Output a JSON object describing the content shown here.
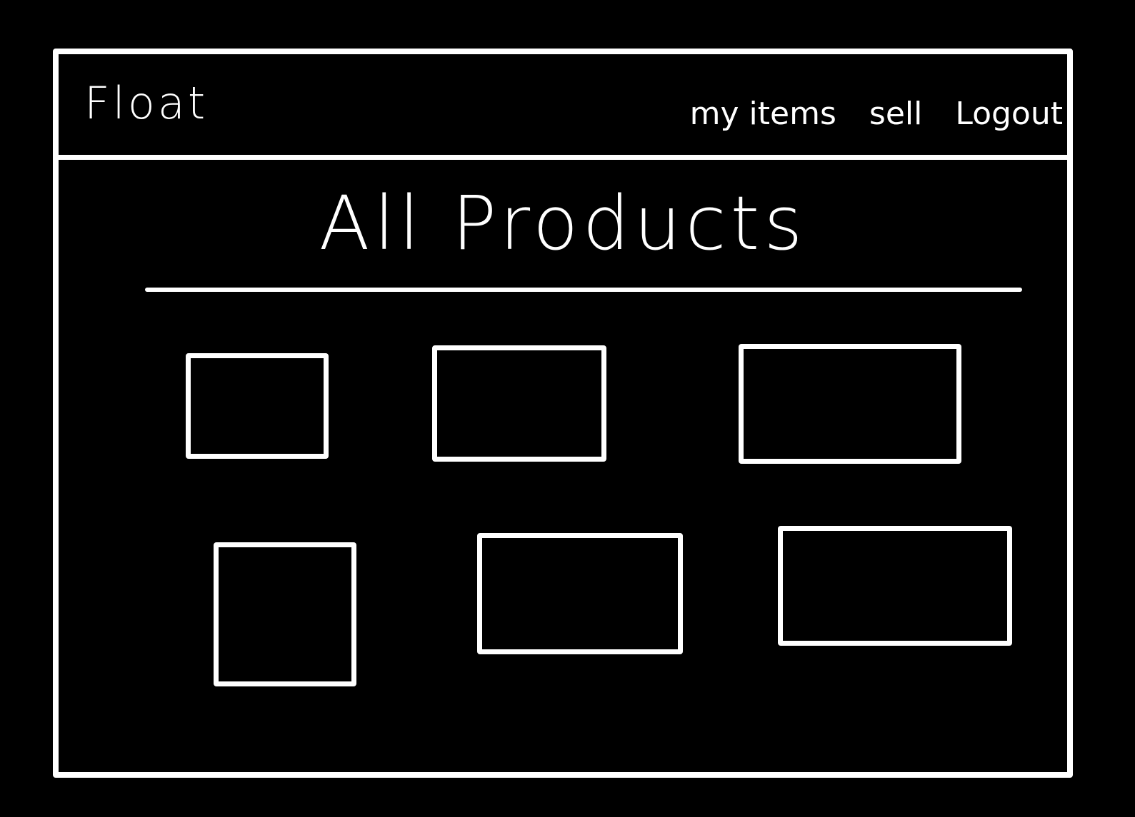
{
  "navbar": {
    "brand": "Float",
    "links": [
      {
        "label": "my items"
      },
      {
        "label": "sell"
      },
      {
        "label": "Logout"
      }
    ]
  },
  "main": {
    "title": "All Products",
    "product_count": 6
  },
  "colors": {
    "background": "#000000",
    "ink": "#ffffff"
  }
}
